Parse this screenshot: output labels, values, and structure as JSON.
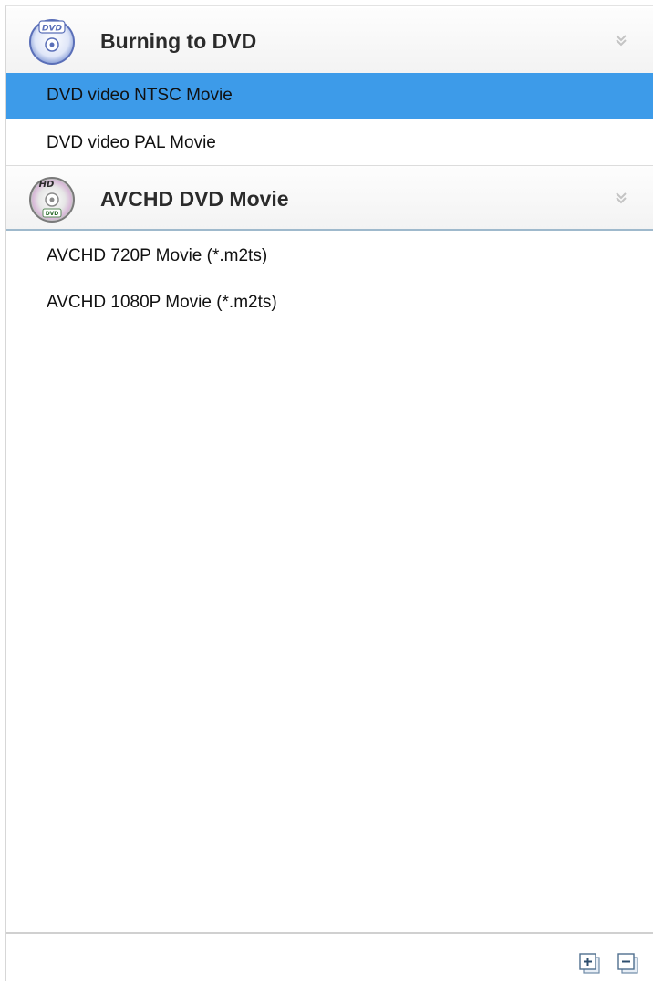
{
  "groups": [
    {
      "title": "Burning to DVD",
      "icon": "dvd-disc-icon",
      "expanded": true,
      "items": [
        {
          "label": "DVD video NTSC Movie",
          "selected": true
        },
        {
          "label": "DVD video PAL Movie",
          "selected": false
        }
      ]
    },
    {
      "title": "AVCHD DVD Movie",
      "icon": "hd-dvd-disc-icon",
      "expanded": true,
      "items": [
        {
          "label": "AVCHD 720P Movie (*.m2ts)",
          "selected": false
        },
        {
          "label": "AVCHD 1080P Movie (*.m2ts)",
          "selected": false
        }
      ]
    }
  ],
  "footer": {
    "buttons": [
      "expand-all-icon",
      "collapse-all-icon"
    ]
  },
  "colors": {
    "selection": "#3d9be9",
    "header_background": "#f3f3f3",
    "text": "#111111"
  }
}
